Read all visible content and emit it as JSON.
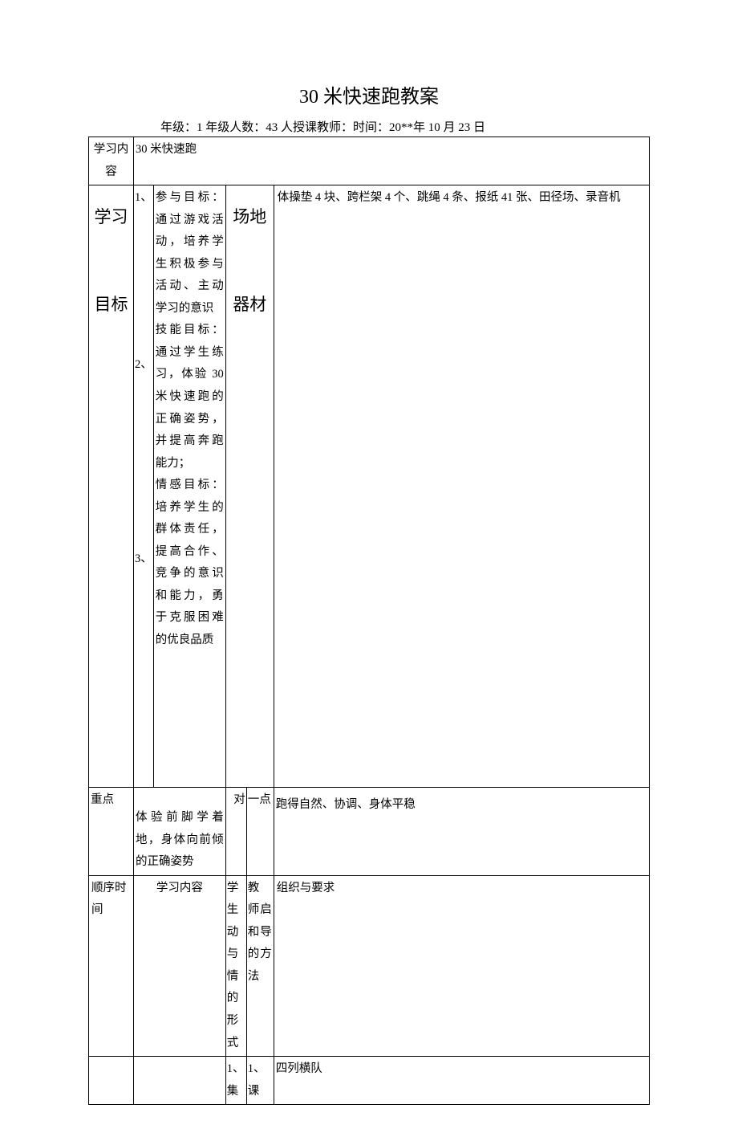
{
  "title": "30 米快速跑教案",
  "meta": "年级：1 年级人数：43 人授课教师：时间：20**年 10 月 23 日",
  "row1": {
    "label": "学习内容",
    "value": "30 米快速跑"
  },
  "goals": {
    "label_line1": "学习",
    "label_line2": "目标",
    "num1": "1、",
    "num2": "2、",
    "num3": "3、",
    "text1": "参与目标：通过游戏活动，培养学生积极参与活动、主动学习的意识",
    "text2": "技能目标：通过学生练习，体验 30米快速跑的正确姿势，并提高奔跑能力；",
    "text3": "情感目标：培养学生的群体责任，提高合作、竞争的意识和能力，勇于克服困难的优良品质",
    "label2_line1": "场地",
    "label2_line2": "器材",
    "equipment": "体操垫 4 块、跨栏架 4 个、跳绳 4 条、报纸 41 张、田径场、录音机"
  },
  "keypoints": {
    "label_left": "重点",
    "left_content": "体验前脚学着地，身体向前倾的正确姿势",
    "mid1": "对",
    "mid2": "一点",
    "right_content": "跑得自然、协调、身体平稳"
  },
  "header_row": {
    "c1": "顺序时间",
    "c2": "学习内容",
    "c3": "学生动与情的形式",
    "c4": "教　师启　和导　的方法",
    "c5": "组织与要求"
  },
  "last_row": {
    "c3": "1、集",
    "c4": "1、课",
    "c5": "四列横队"
  }
}
